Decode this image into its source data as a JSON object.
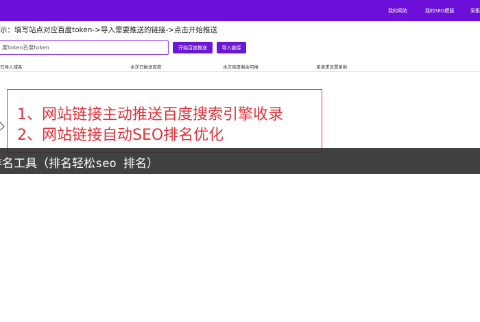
{
  "colors": {
    "topbar": "#6c0fd8",
    "button": "#6c16d6",
    "overlay_red": "#e0323a",
    "caption_bg": "#333333"
  },
  "nav": {
    "items": [
      {
        "label": "我的网站"
      },
      {
        "label": "我的SEO模版"
      },
      {
        "label": "采集"
      }
    ]
  },
  "hint": {
    "text": "示：填写站点对应百度token->导入需要推送的链接->点击开始推送"
  },
  "token_input": {
    "placeholder": "度token百度token"
  },
  "buttons": {
    "start_label": "开始百度推送",
    "import_label": "导入链接"
  },
  "table": {
    "columns": [
      "已导入域名",
      "本次已推送百度",
      "本次百度剩余可推",
      "单请求设置条数"
    ]
  },
  "overlay": {
    "lines": [
      "1、网站链接主动推送百度搜索引擎收录",
      "2、网站链接自动SEO排名优化"
    ]
  },
  "caption": {
    "text": "排名工具（排名轻松seo 排名）"
  }
}
